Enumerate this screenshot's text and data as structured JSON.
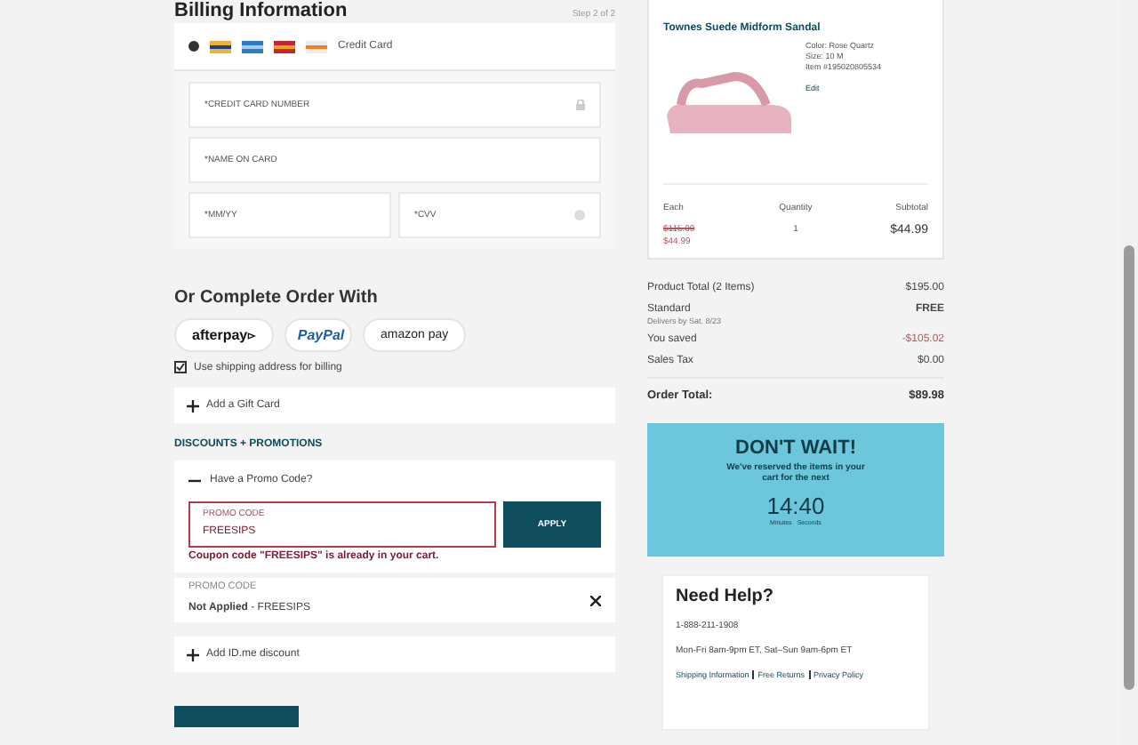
{
  "billing": {
    "title": "Billing Information",
    "step": "Step 2 of 2",
    "payment_option": {
      "label": "Credit Card",
      "selected": true
    },
    "fields": [
      {
        "placeholder": "*CREDIT CARD NUMBER"
      },
      {
        "placeholder": "*NAME ON CARD"
      },
      {
        "placeholder": "*MM/YY"
      },
      {
        "placeholder": "*CVV"
      }
    ]
  },
  "alt_payment": {
    "title": "Or Complete Order With",
    "methods": [
      {
        "kind": "afterpay",
        "label": "afterpay"
      },
      {
        "kind": "paypal",
        "label": "PayPal"
      },
      {
        "kind": "amazon",
        "label": "amazon pay"
      }
    ]
  },
  "billing_same": {
    "label": "Use shipping address for billing",
    "checked": true
  },
  "gift_card": {
    "label": "Add a Gift Card"
  },
  "discounts": {
    "title": "DISCOUNTS + PROMOTIONS",
    "promo": {
      "label": "Have a Promo Code?",
      "expanded": true,
      "field_label": "PROMO CODE",
      "value": "FREESIPS",
      "button": "APPLY",
      "error": "Coupon code \"FREESIPS\" is already in your cart."
    },
    "applied": {
      "label": "PROMO CODE",
      "text": "**Not Applied** - FREESIPS"
    },
    "idme": {
      "label": "Add ID.me discount"
    }
  },
  "cart_item": {
    "name": "Townes Suede Midform Sandal",
    "details": [
      "Color: Rose Quartz",
      "Size: 10 M",
      "Item #195020805534"
    ],
    "edit": "Edit",
    "columns": [
      "Each",
      "Quantity",
      "Subtotal"
    ],
    "original_price": "$115.00",
    "sale_price": "$44.99",
    "quantity": "1",
    "subtotal": "$44.99"
  },
  "summary": {
    "rows": [
      {
        "kind": "plain",
        "label": "Product Total (2 Items)",
        "value": "$195.00"
      },
      {
        "kind": "bold",
        "label": "Standard",
        "note": "Delivers by Sat. 8/23",
        "value": "FREE"
      },
      {
        "kind": "discount",
        "label": "You saved",
        "value": "-$105.02"
      },
      {
        "kind": "plain",
        "label": "Sales Tax",
        "value": "$0.00"
      }
    ],
    "total": {
      "label": "Order Total:",
      "value": "$89.98"
    }
  },
  "timer": {
    "title": "DON'T WAIT!",
    "message": "We've reserved the items in your cart for the next",
    "time": "14:40",
    "units": [
      "Minutes",
      "Seconds"
    ]
  },
  "help": {
    "title": "Need Help?",
    "phone": "1-888-211-1908",
    "hours": "Mon-Fri 8am-9pm ET, Sat–Sun 9am-6pm ET",
    "links": [
      "Shipping Information",
      "Free Returns",
      "Privacy Policy"
    ]
  }
}
